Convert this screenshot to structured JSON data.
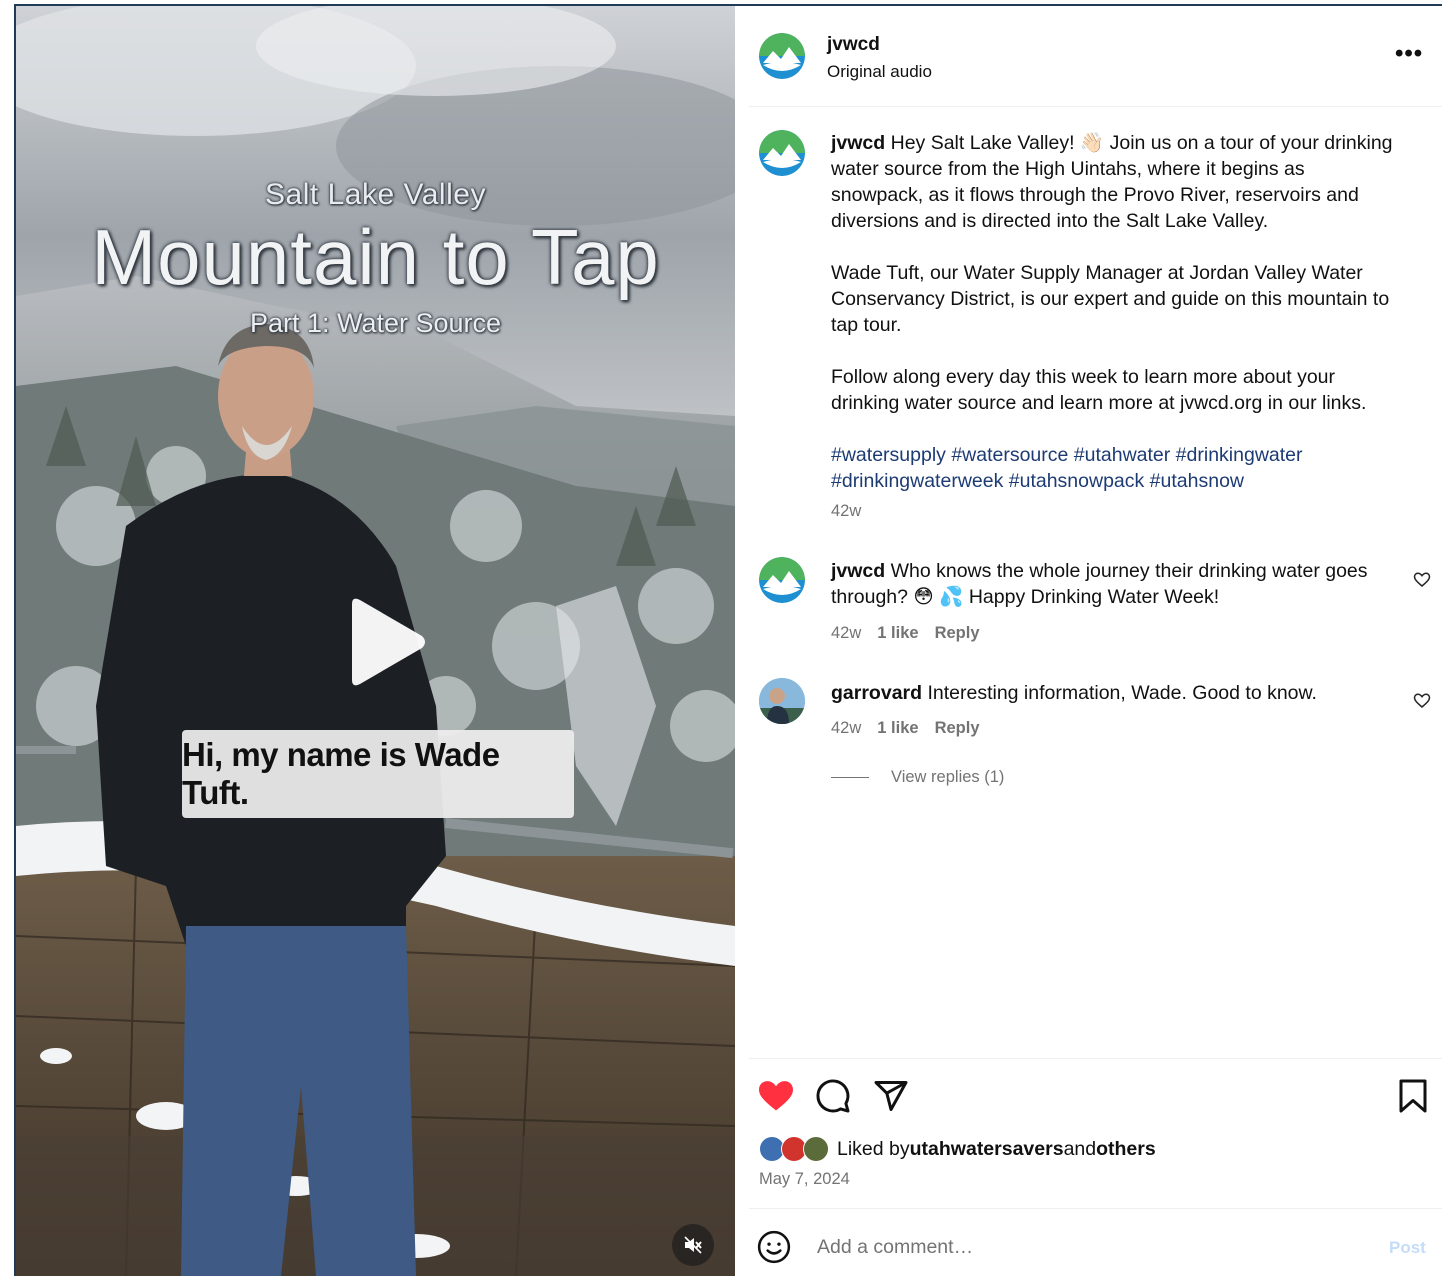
{
  "video": {
    "title_small": "Salt Lake Valley",
    "title_big": "Mountain to Tap",
    "title_part": "Part 1: Water Source",
    "caption": "Hi, my name is Wade Tuft."
  },
  "header": {
    "username": "jvwcd",
    "audio": "Original audio"
  },
  "post": {
    "username": "jvwcd",
    "caption_line1_rest": " Hey Salt Lake Valley! 👋🏻 Join us on a tour of your drinking",
    "caption_line2": "water source from the High Uintahs, where it begins as",
    "caption_line3": "snowpack, as it flows through the Provo River, reservoirs and",
    "caption_line4": "diversions and is directed into the Salt Lake Valley.",
    "para2_line1": "Wade Tuft, our Water Supply Manager at Jordan Valley Water",
    "para2_line2": "Conservancy District, is our expert and guide on this mountain to",
    "para2_line3": "tap tour.",
    "para3_line1": "Follow along every day this week to learn more about your",
    "para3_line2": "drinking water source and learn more at jvwcd.org in our links.",
    "hashtags_line1": "#watersupply #watersource #utahwater #drinkingwater",
    "hashtags_line2": "#drinkingwaterweek #utahsnowpack #utahsnow",
    "age": "42w"
  },
  "comments": [
    {
      "username": "jvwcd",
      "text_line1": " Who knows the whole journey their drinking water goes",
      "text_line2": "through? 😳 💦 Happy Drinking Water Week!",
      "age": "42w",
      "likes": "1 like",
      "reply": "Reply"
    },
    {
      "username": "garrovard",
      "text_line1": " Interesting information, Wade. Good to know.",
      "age": "42w",
      "likes": "1 like",
      "reply": "Reply",
      "view_replies": "View replies (1)"
    }
  ],
  "likes": {
    "prefix": "Liked by ",
    "user": "utahwatersavers",
    "middle": " and ",
    "others": "others"
  },
  "date": "May 7, 2024",
  "composer": {
    "placeholder": "Add a comment…",
    "post": "Post"
  },
  "colors": {
    "like_red": "#ff3040",
    "hashtag_blue": "#1d3b73",
    "muted": "#737373",
    "post_disabled": "#c4dcf7"
  },
  "icons": [
    "play-icon",
    "mute-icon",
    "more-icon",
    "heart-icon",
    "comment-icon",
    "share-icon",
    "bookmark-icon",
    "emoji-icon"
  ]
}
